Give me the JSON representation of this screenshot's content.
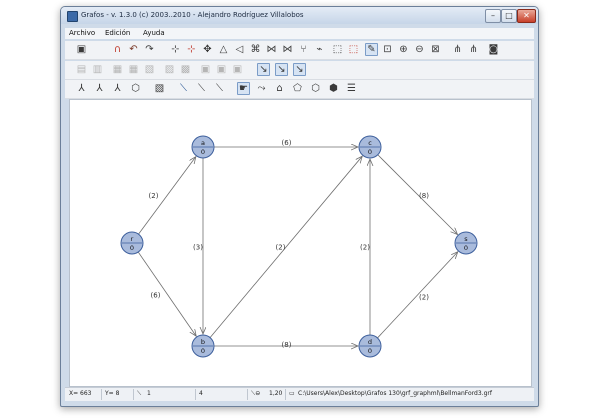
{
  "window": {
    "title": "Grafos - v. 1.3.0  (c) 2003..2010 - Alejandro Rodríguez Villalobos",
    "minimize": "–",
    "maximize": "□",
    "close": "✕"
  },
  "menu": [
    "Archivo",
    "Edición",
    "Ayuda"
  ],
  "colors": {
    "node_fill": "#a9bbdc",
    "node_stroke": "#3d5f9c",
    "edge": "#6f6f6f"
  },
  "graph": {
    "nodes": [
      {
        "id": "r",
        "label": "r",
        "value": "0"
      },
      {
        "id": "a",
        "label": "a",
        "value": "0"
      },
      {
        "id": "b",
        "label": "b",
        "value": "0"
      },
      {
        "id": "c",
        "label": "c",
        "value": "0"
      },
      {
        "id": "d",
        "label": "d",
        "value": "0"
      },
      {
        "id": "s",
        "label": "s",
        "value": "0"
      }
    ],
    "edges": [
      {
        "from": "r",
        "to": "a",
        "weight": "(2)"
      },
      {
        "from": "r",
        "to": "b",
        "weight": "(6)"
      },
      {
        "from": "a",
        "to": "c",
        "weight": "(6)"
      },
      {
        "from": "a",
        "to": "b",
        "weight": "(3)"
      },
      {
        "from": "b",
        "to": "c",
        "weight": "(2)"
      },
      {
        "from": "b",
        "to": "d",
        "weight": "(8)"
      },
      {
        "from": "d",
        "to": "c",
        "weight": "(2)"
      },
      {
        "from": "c",
        "to": "s",
        "weight": "(8)"
      },
      {
        "from": "d",
        "to": "s",
        "weight": "(2)"
      }
    ]
  },
  "status": {
    "x": "X= 663",
    "y": "Y= 8",
    "edges_count": "1",
    "nodes_count": "4",
    "zoom": "1,20",
    "file_path": "C:\\Users\\Alex\\Desktop\\Grafos 130\\grf_graphml\\BellmanFord3.grf"
  },
  "toolbar_icons": {
    "row1": [
      "graph-view-icon",
      "magnet-icon",
      "undo-icon",
      "redo-icon",
      "add-node-icon",
      "add-node-red-icon",
      "move-node-icon",
      "triangle-icon",
      "arrow-left-icon",
      "connect-icon",
      "network-icon",
      "network-alt-icon",
      "branch-icon",
      "edge-icon",
      "select-icon",
      "select-red-icon",
      "pointer-icon",
      "zoom-fit-icon",
      "zoom-in-icon",
      "zoom-out-icon",
      "zoom-window-icon",
      "tree-icon",
      "tree-alt-icon",
      "camera-icon"
    ],
    "row2": [
      "table-icon",
      "print-icon",
      "matrix-icon",
      "matrix-alt-icon",
      "list-icon",
      "grid-a-icon",
      "grid-b-icon",
      "grid-c-icon",
      "grid-d-icon",
      "grid-e-icon",
      "edge-a-icon",
      "edge-b-icon",
      "edge-c-icon"
    ],
    "row3": [
      "tree-layout-icon",
      "route-icon",
      "flow-icon",
      "cycle-icon",
      "report-icon",
      "single-edge-icon",
      "double-edge-icon",
      "multi-edge-icon",
      "hand-icon",
      "shape-a-icon",
      "shape-b-icon",
      "shape-c-icon",
      "shape-d-icon",
      "shape-e-icon",
      "shape-f-icon"
    ]
  }
}
